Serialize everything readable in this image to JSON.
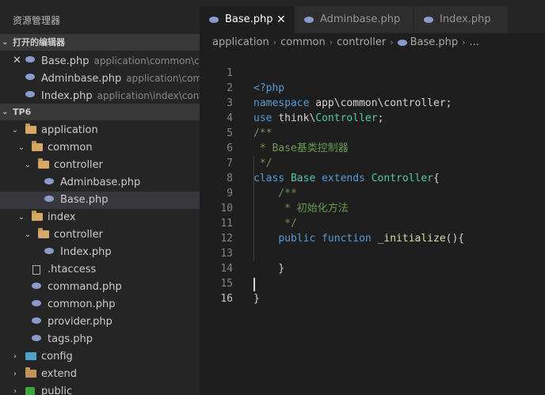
{
  "sidebar": {
    "title": "资源管理器",
    "open_editors_header": "打开的编辑器",
    "open_editors": [
      {
        "name": "Base.php",
        "path": "application\\common\\con..."
      },
      {
        "name": "Adminbase.php",
        "path": "application\\comm..."
      },
      {
        "name": "Index.php",
        "path": "application\\index\\contro..."
      }
    ],
    "project_header": "TP6",
    "tree": {
      "application": "application",
      "common": "common",
      "controller1": "controller",
      "adminbase": "Adminbase.php",
      "base": "Base.php",
      "index": "index",
      "controller2": "controller",
      "indexphp": "Index.php",
      "htaccess": ".htaccess",
      "command": "command.php",
      "commonphp": "common.php",
      "provider": "provider.php",
      "tags": "tags.php",
      "config": "config",
      "extend": "extend",
      "public": "public"
    }
  },
  "tabs": [
    {
      "label": "Base.php",
      "close": "✕"
    },
    {
      "label": "Adminbase.php"
    },
    {
      "label": "Index.php"
    }
  ],
  "breadcrumb": [
    "application",
    "common",
    "controller",
    "Base.php",
    "..."
  ],
  "code": {
    "line_numbers": [
      "1",
      "2",
      "3",
      "4",
      "5",
      "6",
      "7",
      "8",
      "9",
      "10",
      "11",
      "12",
      "13",
      "14",
      "15",
      "16"
    ],
    "l1_open": "<?php",
    "l2_kw": "namespace",
    "l2_ns": "app\\common\\controller",
    "l2_semi": ";",
    "l3_kw": "use",
    "l3_ns1": "think\\",
    "l3_cls": "Controller",
    "l3_semi": ";",
    "l4": "/**",
    "l5": " * Base基类控制器",
    "l6": " */",
    "l7_class": "class",
    "l7_name": "Base",
    "l7_extends": "extends",
    "l7_parent": "Controller",
    "l7_brace": "{",
    "l8": "    /**",
    "l9": "     * 初始化方法",
    "l10": "     */",
    "l11_public": "public",
    "l11_function": "function",
    "l11_name": "_initialize",
    "l11_rest": "(){",
    "l13": "    }",
    "l15": "}"
  },
  "colors": {
    "keyword": "#569cd6",
    "type": "#4ec9b0",
    "comment": "#6a9955",
    "function": "#dcdcaa"
  }
}
